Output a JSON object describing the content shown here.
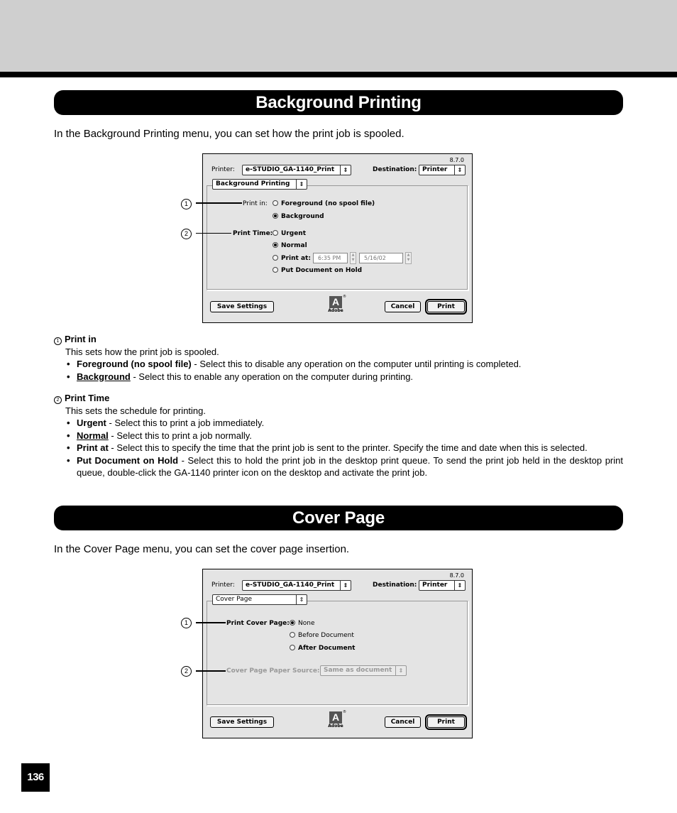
{
  "sections": [
    {
      "title": "Background Printing",
      "intro": "In the Background Printing menu, you can set how the print job is spooled.",
      "dialog": {
        "version": "8.7.0",
        "printer_label": "Printer:",
        "printer_value": "e-STUDIO_GA-1140_Print",
        "destination_label": "Destination:",
        "destination_value": "Printer",
        "panel_menu": "Background Printing",
        "print_in_label": "Print in:",
        "print_in_options": [
          {
            "label": "Foreground (no spool file)",
            "selected": false
          },
          {
            "label": "Background",
            "selected": true
          }
        ],
        "print_time_label": "Print Time:",
        "print_time_options": [
          {
            "label": "Urgent",
            "selected": false
          },
          {
            "label": "Normal",
            "selected": true
          },
          {
            "label": "Print at:",
            "selected": false
          },
          {
            "label": "Put Document on Hold",
            "selected": false
          }
        ],
        "time_value": "6:35 PM",
        "date_value": "5/16/02",
        "save_settings": "Save Settings",
        "adobe": "Adobe",
        "cancel": "Cancel",
        "print": "Print"
      },
      "callouts": [
        "1",
        "2"
      ],
      "desc": [
        {
          "num": "1",
          "heading": "Print in",
          "summary": "This sets how the print job is spooled.",
          "items": [
            {
              "term": "Foreground (no spool file)",
              "underline": false,
              "text": " - Select this to disable any operation on the computer until printing is completed."
            },
            {
              "term": "Background",
              "underline": true,
              "text": " - Select this to enable any operation on the computer during printing."
            }
          ]
        },
        {
          "num": "2",
          "heading": "Print Time",
          "summary": "This sets the schedule for printing.",
          "items": [
            {
              "term": "Urgent",
              "underline": false,
              "text": " - Select this to print a job immediately."
            },
            {
              "term": "Normal",
              "underline": true,
              "text": " - Select this to print a job normally."
            },
            {
              "term": "Print at",
              "underline": false,
              "text": " - Select this to specify the time that the print job is sent to the printer.  Specify the time and date when this is selected."
            },
            {
              "term": "Put Document on Hold",
              "underline": false,
              "text": " - Select this to hold the print job in the desktop print queue.  To send the print job held in the desktop print queue, double-click the GA-1140 printer icon on the desktop and activate the print job."
            }
          ]
        }
      ]
    },
    {
      "title": "Cover Page",
      "intro": "In the Cover Page menu, you can set the cover page insertion.",
      "dialog": {
        "version": "8.7.0",
        "printer_label": "Printer:",
        "printer_value": "e-STUDIO_GA-1140_Print",
        "destination_label": "Destination:",
        "destination_value": "Printer",
        "panel_menu": "Cover Page",
        "cover_label": "Print Cover Page:",
        "cover_options": [
          {
            "label": "None",
            "selected": true
          },
          {
            "label": "Before Document",
            "selected": false
          },
          {
            "label": "After Document",
            "selected": false
          }
        ],
        "source_label": "Cover Page Paper Source:",
        "source_value": "Same as document",
        "save_settings": "Save Settings",
        "adobe": "Adobe",
        "cancel": "Cancel",
        "print": "Print"
      },
      "callouts": [
        "1",
        "2"
      ]
    }
  ],
  "page_number": "136"
}
